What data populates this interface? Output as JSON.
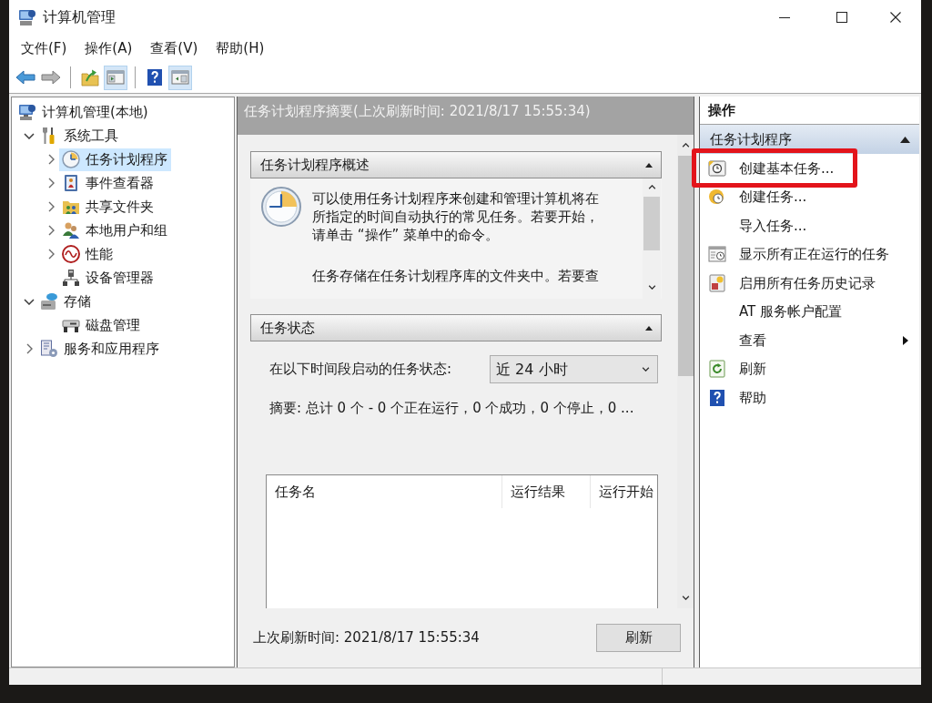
{
  "window": {
    "title": "计算机管理"
  },
  "menu": [
    {
      "label": "文件(F)"
    },
    {
      "label": "操作(A)"
    },
    {
      "label": "查看(V)"
    },
    {
      "label": "帮助(H)"
    }
  ],
  "toolbar": [
    [
      {
        "kind": "back",
        "pressed": false
      },
      {
        "kind": "forward",
        "pressed": false
      }
    ],
    [
      {
        "kind": "up",
        "pressed": false
      },
      {
        "kind": "console-tree",
        "pressed": true
      }
    ],
    [
      {
        "kind": "help",
        "pressed": false
      },
      {
        "kind": "action-pane",
        "pressed": true
      }
    ]
  ],
  "tree": [
    {
      "label": "计算机管理(本地)",
      "kind": "computer",
      "expandable": false,
      "selected": false,
      "children": [
        {
          "label": "系统工具",
          "kind": "tools",
          "expandable": true,
          "expanded": true,
          "selected": false,
          "children": [
            {
              "label": "任务计划程序",
              "kind": "clock",
              "expandable": true,
              "expanded": false,
              "selected": true
            },
            {
              "label": "事件查看器",
              "kind": "event-viewer",
              "expandable": true,
              "expanded": false,
              "selected": false
            },
            {
              "label": "共享文件夹",
              "kind": "shared-folder",
              "expandable": true,
              "expanded": false,
              "selected": false
            },
            {
              "label": "本地用户和组",
              "kind": "users",
              "expandable": true,
              "expanded": false,
              "selected": false
            },
            {
              "label": "性能",
              "kind": "performance",
              "expandable": true,
              "expanded": false,
              "selected": false
            },
            {
              "label": "设备管理器",
              "kind": "device-manager",
              "expandable": false,
              "selected": false
            }
          ]
        },
        {
          "label": "存储",
          "kind": "storage",
          "expandable": true,
          "expanded": true,
          "selected": false,
          "children": [
            {
              "label": "磁盘管理",
              "kind": "disk",
              "expandable": false,
              "selected": false
            }
          ]
        },
        {
          "label": "服务和应用程序",
          "kind": "services",
          "expandable": true,
          "expanded": false,
          "selected": false
        }
      ]
    }
  ],
  "center": {
    "header": "任务计划程序摘要(上次刷新时间: 2021/8/17 15:55:34)",
    "overview": {
      "title": "任务计划程序概述",
      "expanded": true,
      "paragraphs": [
        "可以使用任务计划程序来创建和管理计算机将在所指定的时间自动执行的常见任务。若要开始，请单击 “操作” 菜单中的命令。",
        "任务存储在任务计划程序库的文件夹中。若要查"
      ]
    },
    "status": {
      "title": "任务状态",
      "expanded": true,
      "period_label": "在以下时间段启动的任务状态:",
      "period": "近 24 小时",
      "summary": "摘要: 总计 0 个 - 0 个正在运行，0 个成功，0 个停止，0 ...",
      "columns": [
        "任务名",
        "运行结果",
        "运行开始"
      ]
    },
    "footer": {
      "last_refresh": "上次刷新时间: 2021/8/17 15:55:34",
      "button": "刷新"
    }
  },
  "actions": {
    "title": "操作",
    "group": {
      "title": "任务计划程序",
      "expanded": true,
      "items": [
        {
          "label": "创建基本任务...",
          "kind": "basic-task",
          "submenu": false,
          "highlighted": true
        },
        {
          "label": "创建任务...",
          "kind": "create-task",
          "submenu": false,
          "highlighted": false
        },
        {
          "label": "导入任务...",
          "kind": "none",
          "submenu": false,
          "highlighted": false
        },
        {
          "label": "显示所有正在运行的任务",
          "kind": "running-tasks",
          "submenu": false,
          "highlighted": false
        },
        {
          "label": "启用所有任务历史记录",
          "kind": "history",
          "submenu": false,
          "highlighted": false
        },
        {
          "label": "AT 服务帐户配置",
          "kind": "none",
          "submenu": false,
          "highlighted": false
        },
        {
          "label": "查看",
          "kind": "none",
          "submenu": true,
          "highlighted": false
        },
        {
          "label": "刷新",
          "kind": "refresh",
          "submenu": false,
          "highlighted": false
        },
        {
          "label": "帮助",
          "kind": "help",
          "submenu": false,
          "highlighted": false
        }
      ]
    }
  }
}
